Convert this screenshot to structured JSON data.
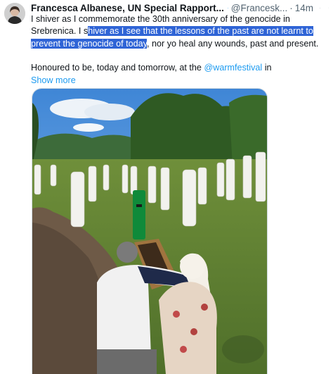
{
  "author": {
    "name": "Francesca Albanese, UN Special Rapport...",
    "handle": "@Francesk...",
    "separator": "·",
    "time": "14m"
  },
  "post": {
    "p1_before": "I shiver as I commemorate the 30th anniversary of the genocide in Srebrenica. I s",
    "p1_highlight": "hiver as I see that the lessons of the past are not learnt to prevent the genocide of today",
    "p1_after": ", nor yo heal any wounds, past and present.",
    "p2_before": "Honoured to be, today and tomorrow, at the ",
    "p2_mention": "@warmfestival",
    "p2_after": " in",
    "show_more": "Show more"
  },
  "colors": {
    "link": "#1d9bf0",
    "verified_badge": "#1d9bf0",
    "selection_highlight": "#2f64d6",
    "secondary_text": "#536471"
  },
  "icons": [
    "avatar",
    "verified-badge-icon",
    "grok-icon",
    "more-options-icon"
  ]
}
